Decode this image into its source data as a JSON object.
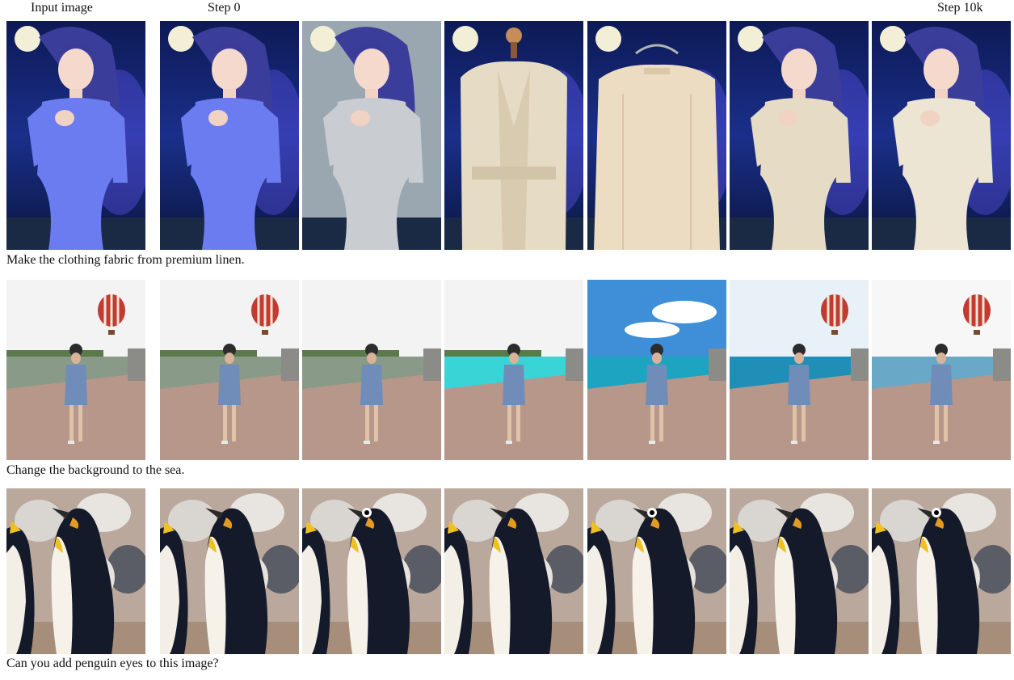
{
  "headers": {
    "input": "Input image",
    "step0": "Step 0",
    "step10k": "Step 10k"
  },
  "rows": [
    {
      "caption": "Make the clothing fabric from premium linen.",
      "tiles": [
        {
          "kind": "fantasy",
          "outfit": "blue-dress"
        },
        {
          "kind": "fantasy",
          "outfit": "blue-dress"
        },
        {
          "kind": "fantasy",
          "outfit": "grey-knit"
        },
        {
          "kind": "fantasy",
          "outfit": "mannequin-coat"
        },
        {
          "kind": "fantasy",
          "outfit": "hanger-shirt"
        },
        {
          "kind": "fantasy",
          "outfit": "linen-wrap"
        },
        {
          "kind": "fantasy",
          "outfit": "linen-offshoulder"
        }
      ]
    },
    {
      "caption": "Change the background to the sea.",
      "tiles": [
        {
          "kind": "lake",
          "water": "lake",
          "balloon": true
        },
        {
          "kind": "lake",
          "water": "lake",
          "balloon": true
        },
        {
          "kind": "lake",
          "water": "lake",
          "balloon": false
        },
        {
          "kind": "lake",
          "water": "pool",
          "balloon": false
        },
        {
          "kind": "lake",
          "water": "sea-clouds",
          "balloon": false
        },
        {
          "kind": "lake",
          "water": "sea",
          "balloon": true
        },
        {
          "kind": "lake",
          "water": "sea-pale",
          "balloon": true
        }
      ]
    },
    {
      "caption": "Can you add penguin eyes to this image?",
      "tiles": [
        {
          "kind": "penguin",
          "eye": false
        },
        {
          "kind": "penguin",
          "eye": false
        },
        {
          "kind": "penguin",
          "eye": true
        },
        {
          "kind": "penguin",
          "eye": false
        },
        {
          "kind": "penguin",
          "eye": true
        },
        {
          "kind": "penguin",
          "eye": false
        },
        {
          "kind": "penguin",
          "eye": true
        }
      ]
    }
  ],
  "colors": {
    "fantasy_sky": "#1a2f8a",
    "fantasy_glow": "#6a5cff",
    "linen": "#e6dcc6",
    "sea": "#1f8fb8",
    "pool": "#38d4d6",
    "lake": "#8a9a88",
    "deck": "#b7978a",
    "penguin_black": "#141a2a",
    "penguin_yellow": "#f0c020"
  }
}
